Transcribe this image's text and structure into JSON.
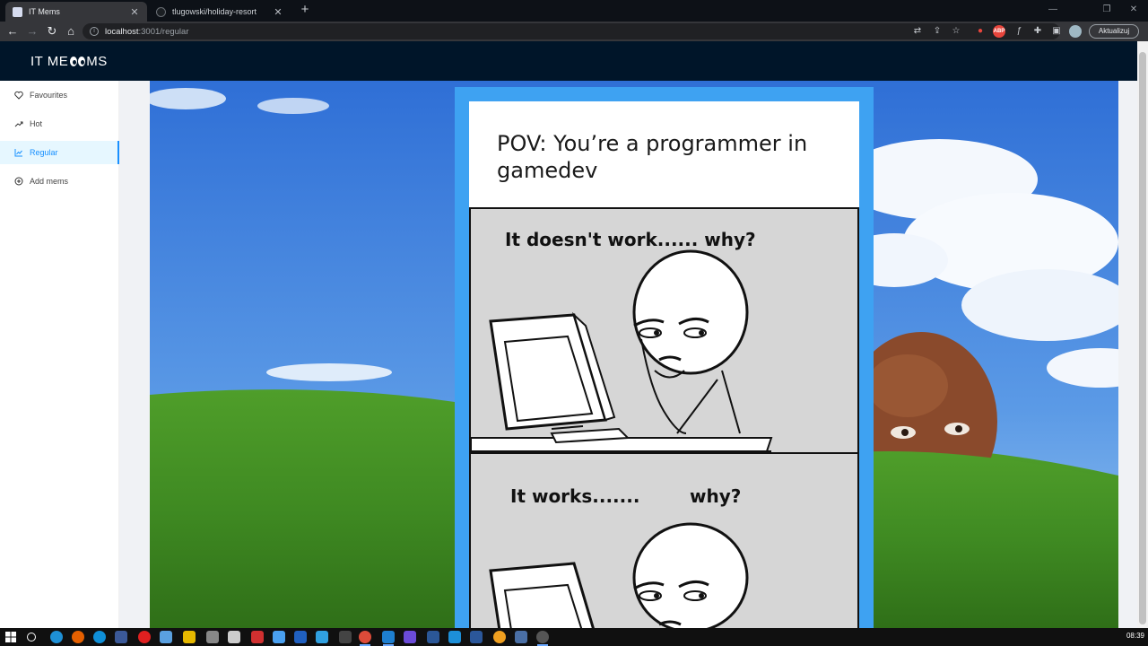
{
  "browser": {
    "tabs": [
      {
        "title": "IT Mems",
        "active": true
      },
      {
        "title": "tlugowski/holiday-resort",
        "active": false
      }
    ],
    "address_host": "localhost",
    "address_path": ":3001/regular",
    "update_button": "Aktualizuj",
    "extensions": [
      "translate-icon",
      "share-icon",
      "star-icon",
      "lastpass-icon",
      "adblock-icon",
      "function-icon",
      "puzzle-icon",
      "sidepanel-icon",
      "profile-avatar"
    ]
  },
  "app": {
    "logo_left": "IT ME",
    "logo_right": "MS"
  },
  "sidebar": {
    "items": [
      {
        "label": "Favourites",
        "icon": "heart-icon",
        "selected": false
      },
      {
        "label": "Hot",
        "icon": "trend-up-icon",
        "selected": false
      },
      {
        "label": "Regular",
        "icon": "line-chart-icon",
        "selected": true
      },
      {
        "label": "Add mems",
        "icon": "plus-circle-icon",
        "selected": false
      }
    ]
  },
  "meme": {
    "caption": "POV: You’re a programmer in gamedev",
    "panel1_text": "It doesn't work...... why?",
    "panel2_text_a": "It works.......",
    "panel2_text_b": "why?"
  },
  "colors": {
    "header_bg": "#001529",
    "accent": "#1890ff",
    "meme_frame": "#3ea2f2"
  },
  "taskbar": {
    "clock": "08:39"
  }
}
